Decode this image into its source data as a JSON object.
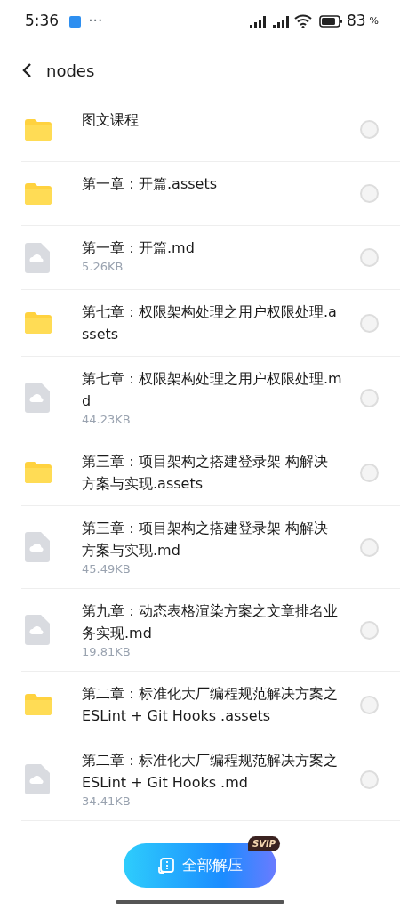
{
  "status_bar": {
    "time": "5:36",
    "dots": "···",
    "battery": "83",
    "battery_unit": "%"
  },
  "header": {
    "title": "nodes"
  },
  "items": [
    {
      "kind": "folder",
      "name": "图文课程",
      "selected": false
    },
    {
      "kind": "folder",
      "name": "第一章：开篇.assets",
      "selected": false
    },
    {
      "kind": "file",
      "name": "第一章：开篇.md",
      "size": "5.26KB",
      "selected": false
    },
    {
      "kind": "folder",
      "name": "第七章：权限架构处理之用户权限处理.assets",
      "selected": false
    },
    {
      "kind": "file",
      "name": "第七章：权限架构处理之用户权限处理.md",
      "size": "44.23KB",
      "selected": false
    },
    {
      "kind": "folder",
      "name": "第三章：项目架构之搭建登录架 构解决方案与实现.assets",
      "selected": false
    },
    {
      "kind": "file",
      "name": "第三章：项目架构之搭建登录架 构解决方案与实现.md",
      "size": "45.49KB",
      "selected": false
    },
    {
      "kind": "file",
      "name": "第九章：动态表格渲染方案之文章排名业务实现.md",
      "size": "19.81KB",
      "selected": false
    },
    {
      "kind": "folder",
      "name": "第二章：标准化大厂编程规范解决方案之ESLint + Git Hooks .assets",
      "selected": false
    },
    {
      "kind": "file",
      "name": "第二章：标准化大厂编程规范解决方案之ESLint + Git Hooks .md",
      "size": "34.41KB",
      "selected": false
    }
  ],
  "action": {
    "label": "全部解压",
    "badge": "SVIP"
  }
}
